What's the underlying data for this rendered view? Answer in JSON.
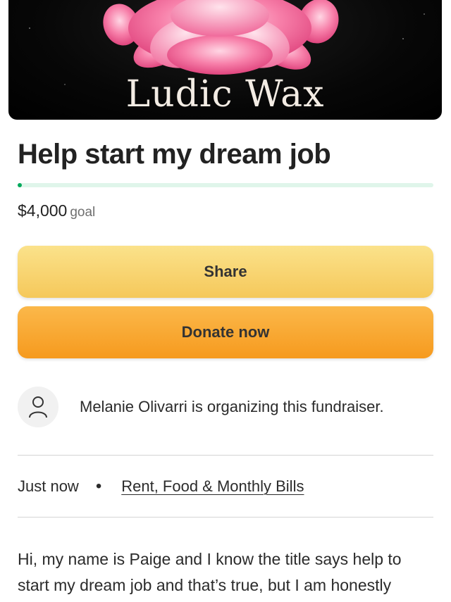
{
  "hero": {
    "brand_text": "Ludic Wax",
    "icon": "peony-flower-image"
  },
  "campaign": {
    "title": "Help start my dream job",
    "progress_fraction": 0.005,
    "goal_amount": "$4,000",
    "goal_label": "goal"
  },
  "actions": {
    "share_label": "Share",
    "donate_label": "Donate now"
  },
  "organizer": {
    "icon": "user-icon",
    "text": "Melanie Olivarri is organizing this fundraiser."
  },
  "meta": {
    "time": "Just now",
    "separator": "•",
    "category": "Rent, Food & Monthly Bills"
  },
  "story": {
    "text": "Hi, my name is Paige and I know the title says help to start my dream job and that’s true, but I am honestly"
  },
  "colors": {
    "progress": "#02a95c",
    "progress_track": "#dff5ea",
    "share_button": "#f7d16a",
    "donate_button": "#f8a52f"
  }
}
